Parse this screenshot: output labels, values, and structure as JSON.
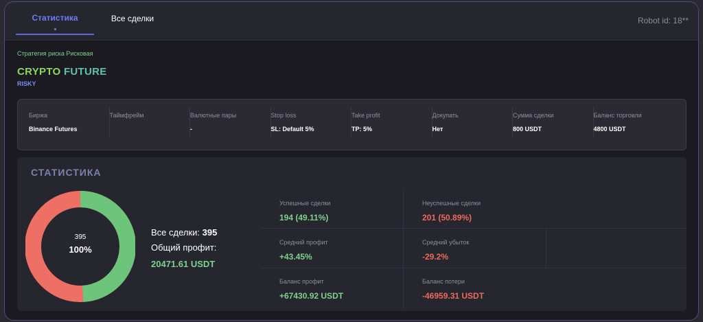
{
  "tabs": [
    {
      "label": "Статистика",
      "active": true
    },
    {
      "label": "Все сделки",
      "active": false
    }
  ],
  "robot_id": "Robot id: 18**",
  "strategy": "Стратегия риска Рисковая",
  "title_part1": "CRYPTO",
  "title_part2": "FUTURE",
  "subtitle": "RISKY",
  "params": [
    {
      "label": "Биржа",
      "value": "Binance Futures"
    },
    {
      "label": "Таймфрейм",
      "value": ""
    },
    {
      "label": "Валютные пары",
      "value": "-"
    },
    {
      "label": "Stop loss",
      "value": "SL: Default 5%"
    },
    {
      "label": "Take profit",
      "value": "TP: 5%"
    },
    {
      "label": "Докупать",
      "value": "Нет"
    },
    {
      "label": "Сумма сделки",
      "value": "800 USDT"
    },
    {
      "label": "Баланс торговли",
      "value": "4800 USDT"
    }
  ],
  "stats": {
    "heading": "СТАТИСТИКА",
    "donut_count": "395",
    "donut_percent": "100%",
    "donut_success_fraction": 0.4911,
    "total_deals_label": "Все сделки:",
    "total_deals_value": "395",
    "profit_label": "Общий профит:",
    "profit_value": "20471.61 USDT",
    "success_label": "Успешные сделки",
    "success_value": "194 (49.11%)",
    "fail_label": "Неуспешные сделки",
    "fail_value": "201 (50.89%)",
    "avg_profit_label": "Средний профит",
    "avg_profit_value": "+43.45%",
    "avg_loss_label": "Средний убыток",
    "avg_loss_value": "-29.2%",
    "balance_profit_label": "Баланс профит",
    "balance_profit_value": "+67430.92 USDT",
    "balance_loss_label": "Баланс потери",
    "balance_loss_value": "-46959.31 USDT"
  },
  "colors": {
    "success": "#6cc57a",
    "fail": "#ee6f64",
    "accent": "#6f7cf7"
  }
}
